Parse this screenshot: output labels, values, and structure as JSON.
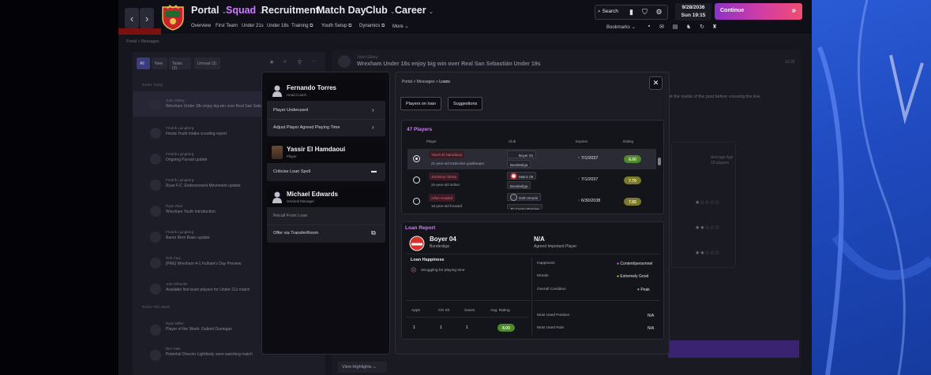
{
  "topnav": {
    "menu": [
      {
        "label": "Portal",
        "active": false
      },
      {
        "label": "Squad",
        "active": true
      },
      {
        "label": "Recruitment",
        "active": false
      },
      {
        "label": "Match Day",
        "active": false
      },
      {
        "label": "Club",
        "active": false
      },
      {
        "label": "Career",
        "active": false
      }
    ],
    "submenu": [
      "Overview",
      "First Team",
      "Under 21s",
      "Under 18s",
      "Training",
      "Youth Setup",
      "Dynamics",
      "More"
    ],
    "search_label": "Search",
    "date": "9/28/2036",
    "time": "Sun  19:15",
    "continue_label": "Continue",
    "bookmarks_label": "Bookmarks"
  },
  "background": {
    "breadcrumb": "Portal  >  Messages",
    "filters": [
      "All",
      "New",
      "Tasks (3)",
      "Unread (3)"
    ],
    "section_today": "Earlier Today",
    "section_week": "Earlier This Week",
    "messages": [
      {
        "from": "John Gilbey",
        "subject": "Wrexham Under 18s enjoy big win over Real San Sebastian"
      },
      {
        "from": "Fredrik Ljungberg",
        "subject": "Fiesta Youth Intake scouting report"
      },
      {
        "from": "Fredrik Ljungberg",
        "subject": "Ongoing Pursuit update"
      },
      {
        "from": "Fredrik Ljungberg",
        "subject": "Ryan F.C. Endorsement Movement update"
      },
      {
        "from": "Ryan Reid",
        "subject": "Wrexham Youth Introduction"
      },
      {
        "from": "Fredrik Ljungberg",
        "subject": "Baron Bern Basic update"
      },
      {
        "from": "Rob Cary",
        "subject": "[PRE] Wrexham 4-1 Fulham's Day Preview"
      },
      {
        "from": "John Wheeler",
        "subject": "Available first team players for Under 21s match"
      },
      {
        "from": "Ryan Miller",
        "subject": "Player of the Week: Gabriel Dunnigan"
      },
      {
        "from": "Ben Gale",
        "subject": "Potential Director Lightbody seen watching match"
      }
    ],
    "header_from": "John Gilbey",
    "header_title": "Wrexham Under 18s enjoy big win over Real San Sebastián Under 19s",
    "header_time": "12:32",
    "body_snippet": "hit the inside of the post before crossing the line.",
    "side_label": "Average Age",
    "side_value": "18 players",
    "view_highlights": "View Highlights"
  },
  "actions_modal": {
    "people": [
      {
        "name": "Fernando Torres",
        "role": "Head Coach",
        "actions": [
          {
            "label": "Player Underused",
            "icon": "chevron"
          },
          {
            "label": "Adjust Player Agreed Playing Time",
            "icon": "chevron"
          }
        ]
      },
      {
        "name": "Yassir El Hamdaoui",
        "role": "Player",
        "actions": [
          {
            "label": "Criticise Loan Spell",
            "icon": "chat"
          }
        ]
      },
      {
        "name": "Michael Edwards",
        "role": "General Manager",
        "actions": [
          {
            "label": "Recall From Loan",
            "icon": "none",
            "disabled": true
          },
          {
            "label": "Offer via TransferRoom",
            "icon": "external"
          }
        ]
      }
    ]
  },
  "loans_modal": {
    "breadcrumb": [
      "Portal",
      "Messages",
      "Loans"
    ],
    "tabs": [
      "Players on loan",
      "Suggestions"
    ],
    "count_title": "47 Players",
    "columns": [
      "Player",
      "Club",
      "Expires",
      "Rating"
    ],
    "players": [
      {
        "name": "Yassir El Hamdaoui",
        "desc": "21-year-old instinctive goalkeeper",
        "club": "Boyer 04",
        "league": "Bundesliga",
        "expires": "7/1/2037",
        "rating": "6.00",
        "selected": true,
        "club_color": "#d9322a",
        "rating_color": "#4f8a2c"
      },
      {
        "name": "Jerónimo Torres",
        "desc": "22-year-old striker",
        "club": "Mainz 05",
        "league": "Bundesliga",
        "expires": "7/1/2037",
        "rating": "7.70",
        "selected": false,
        "club_color": "#e8e8ee",
        "rating_color": "#7b7a2a"
      },
      {
        "name": "Arfon Howlett",
        "desc": "18-year-old forward",
        "club": "Gefn Druids",
        "league": "JD Cymru Premier",
        "expires": "6/30/2038",
        "rating": "7.65",
        "selected": false,
        "club_color": "#2c2c36",
        "rating_color": "#7b7a2a"
      }
    ],
    "report": {
      "title": "Loan Report",
      "club": "Boyer 04",
      "league": "Bundesliga",
      "status_value": "N/A",
      "status_label": "Agreed Important Player",
      "happiness_title": "Loan Happiness",
      "happiness_note": "Struggling for playing time",
      "stats_headers": [
        "Apps",
        "Cln Sh",
        "Saves",
        "Avg. Rating"
      ],
      "stats_values": [
        "1",
        "1",
        "1",
        "8.00"
      ],
      "right_rows": [
        {
          "label": "Happiness",
          "value": "Content/personnel"
        },
        {
          "label": "Morale",
          "value": "Extremely Good"
        },
        {
          "label": "Overall Condition",
          "value": "Peak"
        }
      ],
      "position_rows": [
        {
          "label": "Most Used Position",
          "value": "N/A"
        },
        {
          "label": "Most Used Role",
          "value": "N/A"
        }
      ]
    }
  }
}
